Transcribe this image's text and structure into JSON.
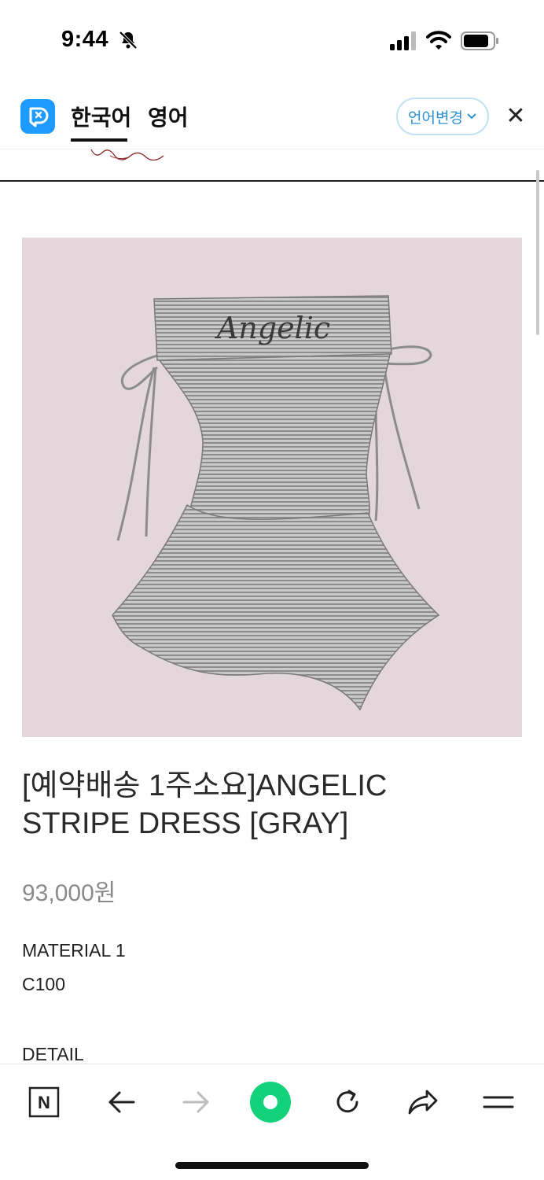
{
  "status_bar": {
    "time": "9:44"
  },
  "translate_bar": {
    "tabs": [
      {
        "label": "한국어",
        "active": true
      },
      {
        "label": "영어",
        "active": false
      }
    ],
    "change_language_label": "언어변경",
    "close_symbol": "✕"
  },
  "product": {
    "title": "[예약배송 1주소요]ANGELIC STRIPE DRESS [GRAY]",
    "price": "93,000원",
    "image_text": "Angelic",
    "material_label": "MATERIAL 1",
    "material_value": "C100",
    "detail_label": "DETAIL"
  },
  "toolbar": {
    "items": [
      {
        "name": "naver-home-icon",
        "letter": "N"
      },
      {
        "name": "back-arrow-icon"
      },
      {
        "name": "forward-arrow-icon"
      },
      {
        "name": "green-dot-icon"
      },
      {
        "name": "refresh-icon"
      },
      {
        "name": "share-icon"
      },
      {
        "name": "menu-icon"
      }
    ]
  },
  "colors": {
    "accent_blue": "#1e9bff",
    "lang_button_text": "#2a8fd4",
    "image_background": "#e4d7dc",
    "green_button": "#12d27a"
  }
}
